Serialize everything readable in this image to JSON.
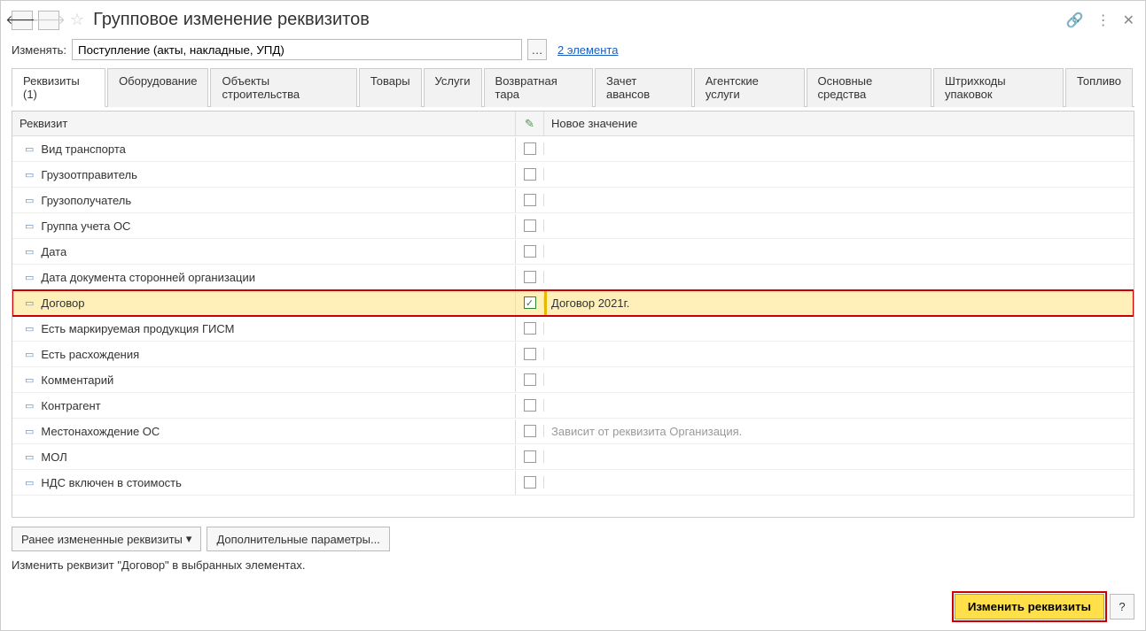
{
  "header": {
    "title": "Групповое изменение реквизитов"
  },
  "filter": {
    "label": "Изменять:",
    "value": "Поступление (акты, накладные, УПД)",
    "link": "2 элемента"
  },
  "tabs": [
    "Реквизиты (1)",
    "Оборудование",
    "Объекты строительства",
    "Товары",
    "Услуги",
    "Возвратная тара",
    "Зачет авансов",
    "Агентские услуги",
    "Основные средства",
    "Штрихкоды упаковок",
    "Топливо"
  ],
  "grid": {
    "headers": {
      "rek": "Реквизит",
      "val": "Новое значение"
    },
    "rows": [
      {
        "name": "Вид транспорта",
        "checked": false,
        "value": ""
      },
      {
        "name": "Грузоотправитель",
        "checked": false,
        "value": ""
      },
      {
        "name": "Грузополучатель",
        "checked": false,
        "value": ""
      },
      {
        "name": "Группа учета ОС",
        "checked": false,
        "value": ""
      },
      {
        "name": "Дата",
        "checked": false,
        "value": ""
      },
      {
        "name": "Дата документа сторонней организации",
        "checked": false,
        "value": ""
      },
      {
        "name": "Договор",
        "checked": true,
        "value": "Договор 2021г.",
        "highlighted": true
      },
      {
        "name": "Есть маркируемая продукция ГИСМ",
        "checked": false,
        "value": ""
      },
      {
        "name": "Есть расхождения",
        "checked": false,
        "value": ""
      },
      {
        "name": "Комментарий",
        "checked": false,
        "value": ""
      },
      {
        "name": "Контрагент",
        "checked": false,
        "value": ""
      },
      {
        "name": "Местонахождение ОС",
        "checked": false,
        "value": "Зависит от реквизита Организация.",
        "muted": true
      },
      {
        "name": "МОЛ",
        "checked": false,
        "value": ""
      },
      {
        "name": "НДС включен в стоимость",
        "checked": false,
        "value": ""
      }
    ]
  },
  "bottom": {
    "history_btn": "Ранее измененные реквизиты",
    "extra_btn": "Дополнительные параметры...",
    "status": "Изменить реквизит \"Договор\" в выбранных элементах."
  },
  "footer": {
    "apply": "Изменить реквизиты",
    "help": "?"
  }
}
